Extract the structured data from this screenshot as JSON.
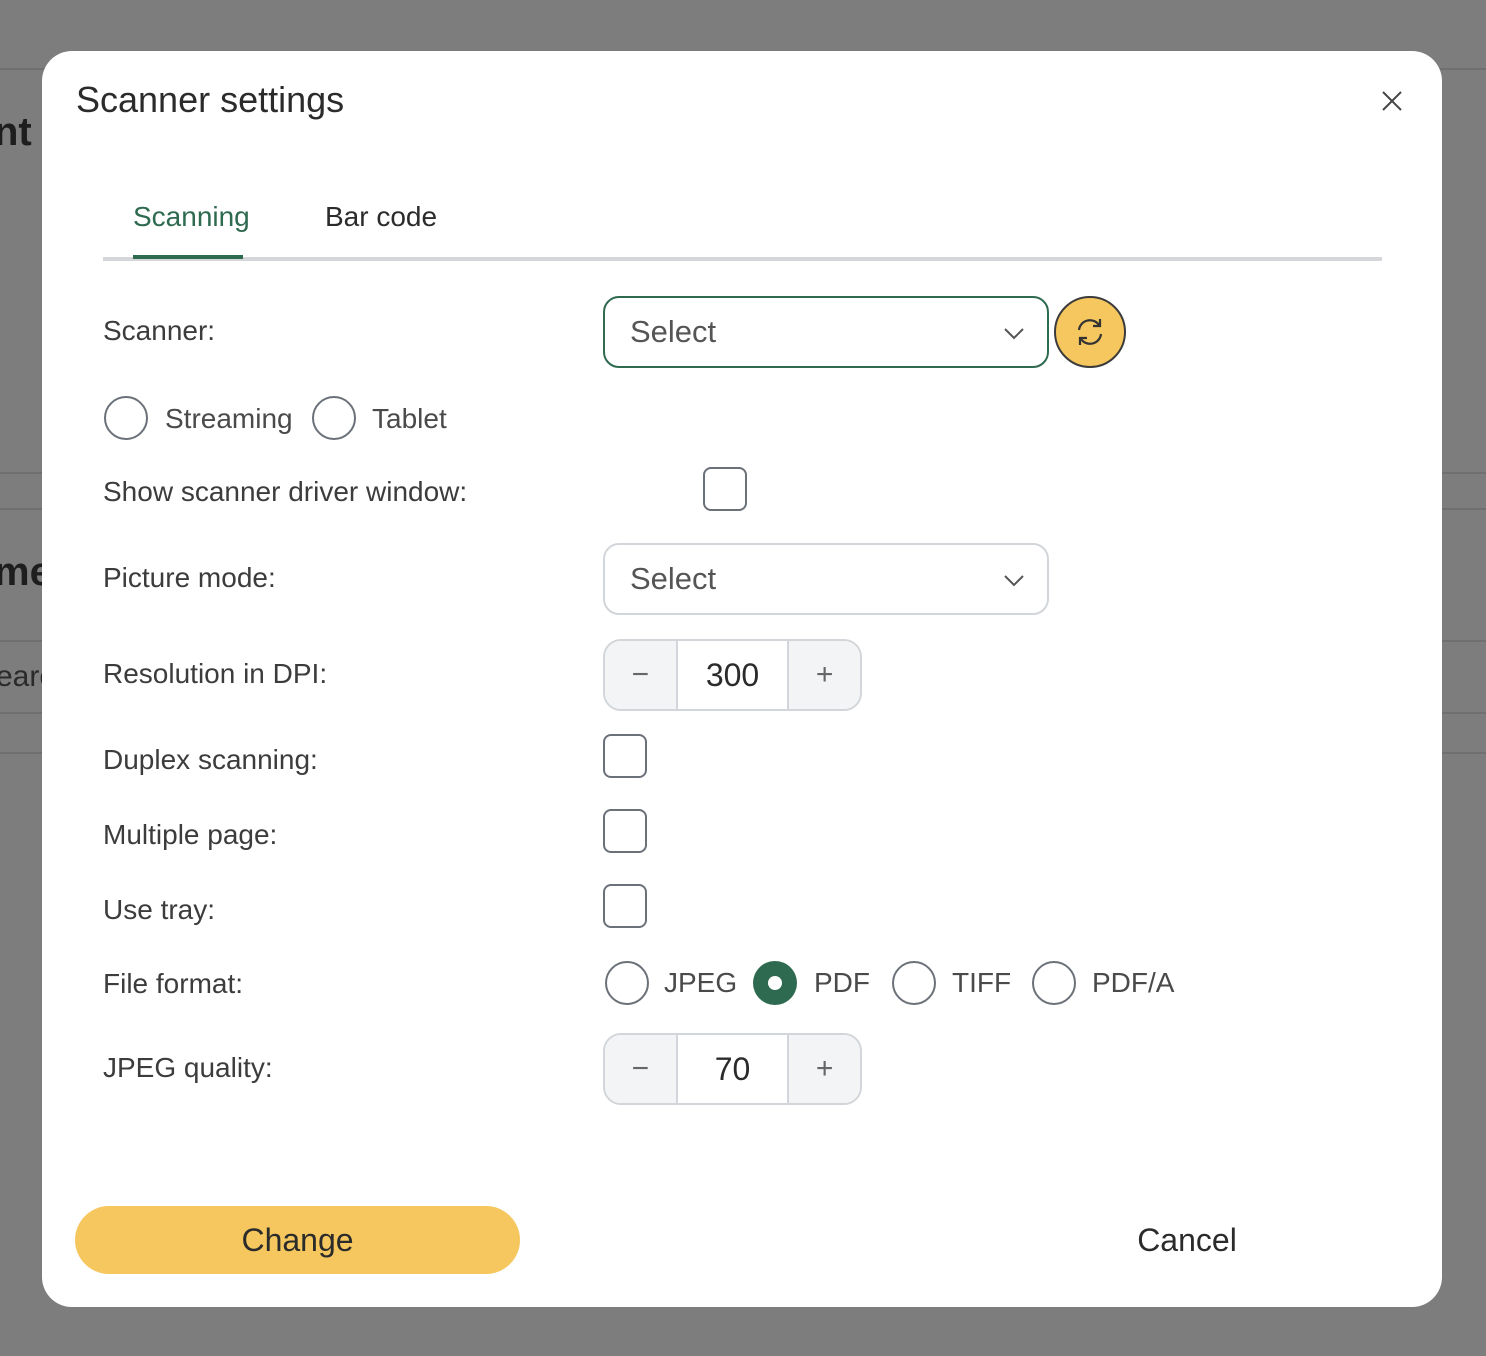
{
  "background": {
    "fragment_1": "nt (",
    "fragment_2": "me",
    "fragment_3": "earc"
  },
  "dialog": {
    "title": "Scanner settings",
    "close_icon": "close-icon"
  },
  "tabs": [
    {
      "label": "Scanning",
      "active": true
    },
    {
      "label": "Bar code",
      "active": false
    }
  ],
  "scanner": {
    "label": "Scanner:",
    "select_value": "Select",
    "refresh_icon": "refresh-icon"
  },
  "mode": {
    "options": [
      {
        "label": "Streaming",
        "checked": false
      },
      {
        "label": "Tablet",
        "checked": false
      }
    ]
  },
  "show_driver_window": {
    "label": "Show scanner driver window:",
    "checked": false
  },
  "picture_mode": {
    "label": "Picture mode:",
    "select_value": "Select"
  },
  "resolution": {
    "label": "Resolution in DPI:",
    "value": "300",
    "minus": "−",
    "plus": "+"
  },
  "duplex": {
    "label": "Duplex scanning:",
    "checked": false
  },
  "multiple_page": {
    "label": "Multiple page:",
    "checked": false
  },
  "use_tray": {
    "label": "Use tray:",
    "checked": false
  },
  "file_format": {
    "label": "File format:",
    "options": [
      {
        "label": "JPEG",
        "checked": false
      },
      {
        "label": "PDF",
        "checked": true
      },
      {
        "label": "TIFF",
        "checked": false
      },
      {
        "label": "PDF/A",
        "checked": false
      }
    ]
  },
  "jpeg_quality": {
    "label": "JPEG quality:",
    "value": "70",
    "minus": "−",
    "plus": "+"
  },
  "footer": {
    "change_label": "Change",
    "cancel_label": "Cancel"
  },
  "colors": {
    "accent_green": "#2e6a4f",
    "accent_yellow": "#f5c75e",
    "overlay": "#7d7d7d"
  }
}
